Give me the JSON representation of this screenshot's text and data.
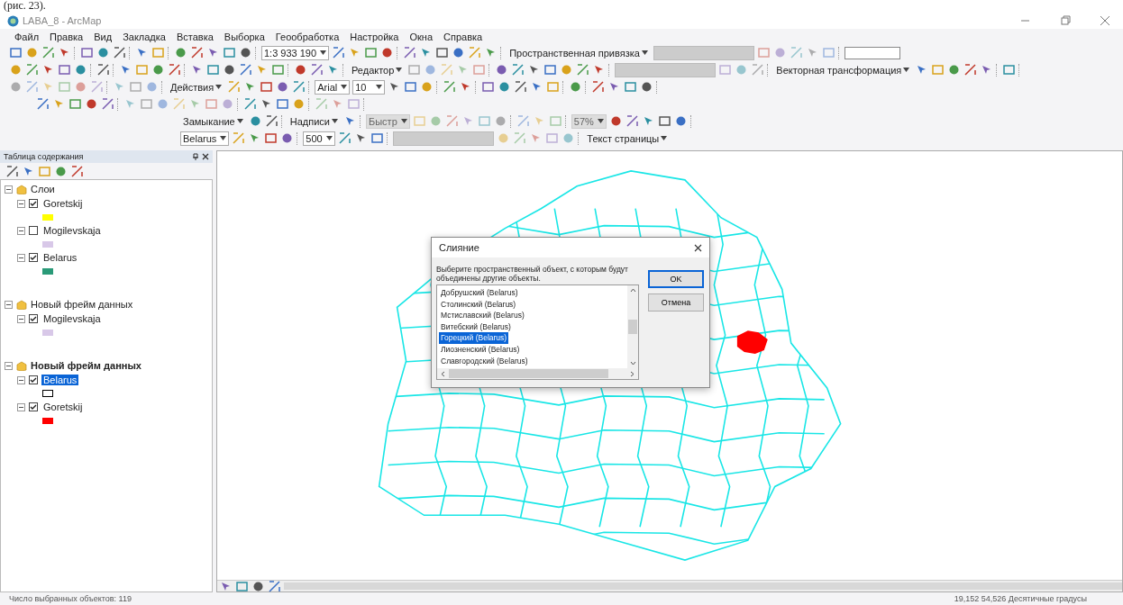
{
  "caption": "(рис. 23).",
  "window": {
    "title": "LABA_8 - ArcMap"
  },
  "menu": [
    "Файл",
    "Правка",
    "Вид",
    "Закладка",
    "Вставка",
    "Выборка",
    "Геообработка",
    "Настройка",
    "Окна",
    "Справка"
  ],
  "toolbars": [
    {
      "indent": false,
      "items": [
        {
          "kind": "tools"
        },
        {
          "kind": "tools"
        },
        {
          "kind": "tools"
        },
        {
          "kind": "tools"
        },
        {
          "kind": "combo",
          "value": "1:3 933 190"
        },
        {
          "kind": "tools"
        },
        {
          "kind": "tools"
        },
        {
          "kind": "menu",
          "label": "Пространственная привязка"
        },
        {
          "kind": "blank"
        },
        {
          "kind": "tools",
          "disabled": true
        },
        {
          "kind": "field"
        }
      ]
    },
    {
      "indent": false,
      "items": [
        {
          "kind": "tools"
        },
        {
          "kind": "tools"
        },
        {
          "kind": "tools"
        },
        {
          "kind": "tools"
        },
        {
          "kind": "tools"
        },
        {
          "kind": "menu",
          "label": "Редактор"
        },
        {
          "kind": "tools",
          "disabled": true
        },
        {
          "kind": "tools"
        },
        {
          "kind": "blank"
        },
        {
          "kind": "tools",
          "disabled": true
        },
        {
          "kind": "menu",
          "label": "Векторная трансформация"
        },
        {
          "kind": "tools"
        },
        {
          "kind": "tools"
        }
      ]
    },
    {
      "indent": false,
      "items": [
        {
          "kind": "tools",
          "disabled": true
        },
        {
          "kind": "tools",
          "disabled": true
        },
        {
          "kind": "menu",
          "label": "Действия"
        },
        {
          "kind": "tools"
        },
        {
          "kind": "combo",
          "value": "Arial"
        },
        {
          "kind": "combo",
          "value": "10"
        },
        {
          "kind": "tools"
        },
        {
          "kind": "tools"
        },
        {
          "kind": "tools"
        },
        {
          "kind": "tools"
        },
        {
          "kind": "tools"
        }
      ]
    },
    {
      "indent": true,
      "items": [
        {
          "kind": "tools"
        },
        {
          "kind": "tools",
          "disabled": true
        },
        {
          "kind": "tools"
        },
        {
          "kind": "tools",
          "disabled": true
        }
      ]
    },
    {
      "indent": true,
      "items": [
        {
          "kind": "menu",
          "label": "Замыкание"
        },
        {
          "kind": "tools"
        },
        {
          "kind": "menu",
          "label": "Надписи"
        },
        {
          "kind": "tools"
        },
        {
          "kind": "combo",
          "value": "Быстр",
          "disabled": true
        },
        {
          "kind": "tools",
          "disabled": true
        },
        {
          "kind": "tools",
          "disabled": true
        },
        {
          "kind": "combo",
          "value": "57%",
          "disabled": true
        },
        {
          "kind": "tools"
        }
      ]
    },
    {
      "indent": true,
      "items": [
        {
          "kind": "combo",
          "value": "Belarus"
        },
        {
          "kind": "tools"
        },
        {
          "kind": "combo",
          "value": "500"
        },
        {
          "kind": "tools"
        },
        {
          "kind": "blank"
        },
        {
          "kind": "tools",
          "disabled": true
        },
        {
          "kind": "menu",
          "label": "Текст страницы"
        }
      ]
    }
  ],
  "toc": {
    "title": "Таблица содержания",
    "frames": [
      {
        "label": "Слои",
        "active": false,
        "expanded": true,
        "children": [
          {
            "label": "Goretskij",
            "checked": true,
            "selected": false,
            "expanded": true,
            "kind": "fill",
            "color": "#ffff00"
          },
          {
            "label": "Mogilevskaja",
            "checked": false,
            "selected": false,
            "expanded": true,
            "kind": "fill",
            "color": "#d8c8e8"
          },
          {
            "label": "Belarus",
            "checked": true,
            "selected": false,
            "expanded": true,
            "kind": "fill",
            "color": "#2a9a78"
          }
        ]
      },
      {
        "label": "Новый фрейм данных",
        "active": false,
        "expanded": true,
        "children": [
          {
            "label": "Mogilevskaja",
            "checked": true,
            "selected": false,
            "expanded": true,
            "kind": "fill",
            "color": "#d8c8e8"
          }
        ]
      },
      {
        "label": "Новый фрейм данных",
        "active": true,
        "expanded": true,
        "children": [
          {
            "label": "Belarus",
            "checked": true,
            "selected": true,
            "expanded": true,
            "kind": "outline",
            "color": "#000000"
          },
          {
            "label": "Goretskij",
            "checked": true,
            "selected": false,
            "expanded": true,
            "kind": "fill",
            "color": "#ff0000"
          }
        ]
      }
    ]
  },
  "dialog": {
    "title": "Слияние",
    "prompt": "Выберите пространственный объект, с которым будут объединены другие объекты.",
    "items": [
      {
        "label": "Добрушский (Belarus)",
        "selected": false
      },
      {
        "label": "Столинский (Belarus)",
        "selected": false
      },
      {
        "label": "Мстиславский (Belarus)",
        "selected": false
      },
      {
        "label": "Витебский (Belarus)",
        "selected": false
      },
      {
        "label": "Горецкий (Belarus)",
        "selected": true
      },
      {
        "label": "Лиозненский (Belarus)",
        "selected": false
      },
      {
        "label": "Славгородский (Belarus)",
        "selected": false
      }
    ],
    "buttons": [
      {
        "label": "OK",
        "default": true
      },
      {
        "label": "Отмена",
        "default": false
      }
    ]
  },
  "status_bar": {
    "left": "Число выбранных объектов: 119",
    "right": "19,152  54,526 Десятичные градусы"
  }
}
